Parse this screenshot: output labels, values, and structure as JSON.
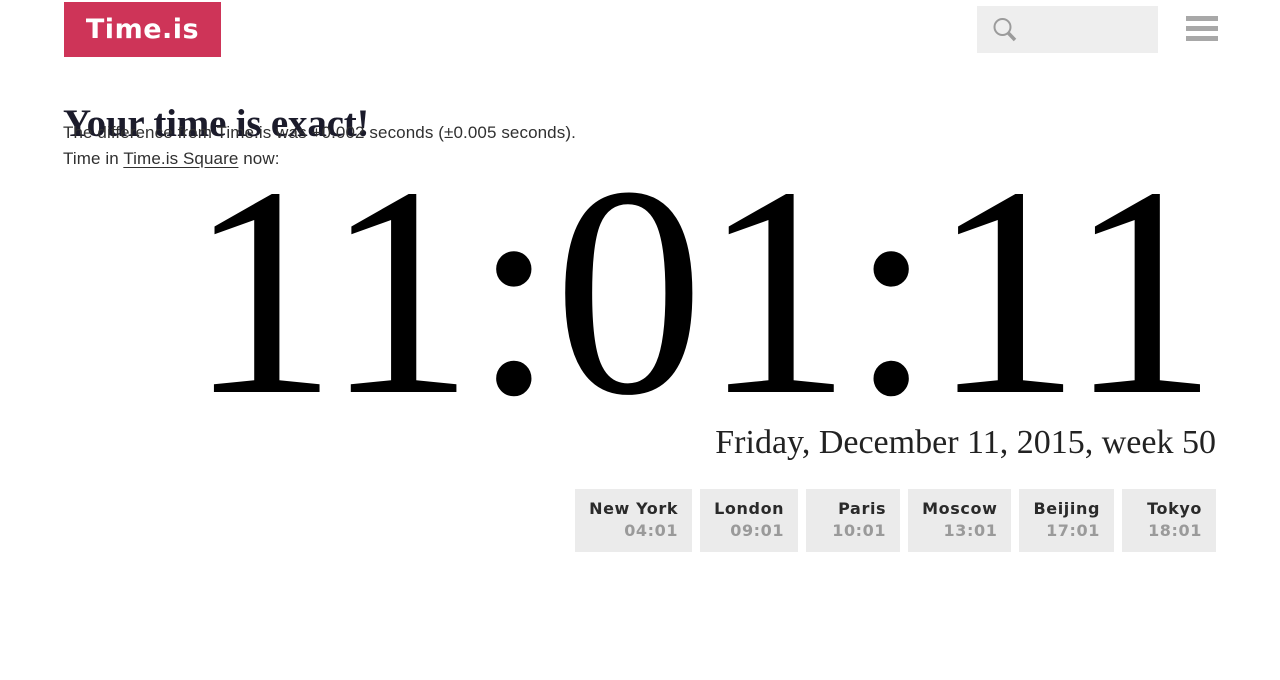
{
  "header": {
    "logo_text": "Time.is",
    "logo_color": "#ce3458",
    "search": {
      "value": "",
      "placeholder": "",
      "icon": "search-icon"
    },
    "menu_icon": "hamburger-menu-icon"
  },
  "main": {
    "headline": "Your time is exact!",
    "difference_line": "The difference from Time.is was +0.002 seconds (±0.005 seconds).",
    "location_line_prefix": "Time in ",
    "location_link": "Time.is Square",
    "location_line_suffix": " now:",
    "clock": "11:01:11",
    "date": "Friday, December 11, 2015, week 50"
  },
  "cities": [
    {
      "name": "New York",
      "time": "04:01"
    },
    {
      "name": "London",
      "time": "09:01"
    },
    {
      "name": "Paris",
      "time": "10:01"
    },
    {
      "name": "Moscow",
      "time": "13:01"
    },
    {
      "name": "Beijing",
      "time": "17:01"
    },
    {
      "name": "Tokyo",
      "time": "18:01"
    }
  ]
}
